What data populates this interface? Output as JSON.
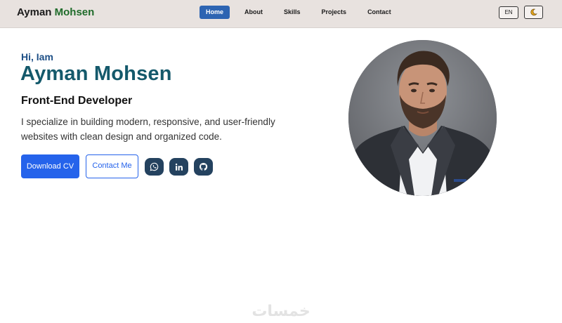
{
  "header": {
    "brand_first": "Ayman",
    "brand_last": "Mohsen",
    "nav": [
      {
        "label": "Home",
        "active": true
      },
      {
        "label": "About",
        "active": false
      },
      {
        "label": "Skills",
        "active": false
      },
      {
        "label": "Projects",
        "active": false
      },
      {
        "label": "Contact",
        "active": false
      }
    ],
    "language_label": "EN",
    "theme_icon": "moon-icon"
  },
  "hero": {
    "greeting": "Hi, Iam",
    "name": "Ayman Mohsen",
    "role": "Front-End Developer",
    "bio": "I specialize in building modern, responsive, and user-friendly websites with clean design and organized code.",
    "download_label": "Download CV",
    "contact_label": "Contact Me",
    "socials": [
      {
        "icon": "whatsapp-icon"
      },
      {
        "icon": "linkedin-icon"
      },
      {
        "icon": "github-icon"
      }
    ]
  },
  "watermark": "خمسات",
  "colors": {
    "header_bg": "#e8e2df",
    "primary": "#2563eb",
    "nav_active": "#2d64b2",
    "name": "#14596b",
    "greeting": "#1d4f86",
    "brand_accent": "#1f6b2a",
    "social_bg": "#24425f"
  }
}
